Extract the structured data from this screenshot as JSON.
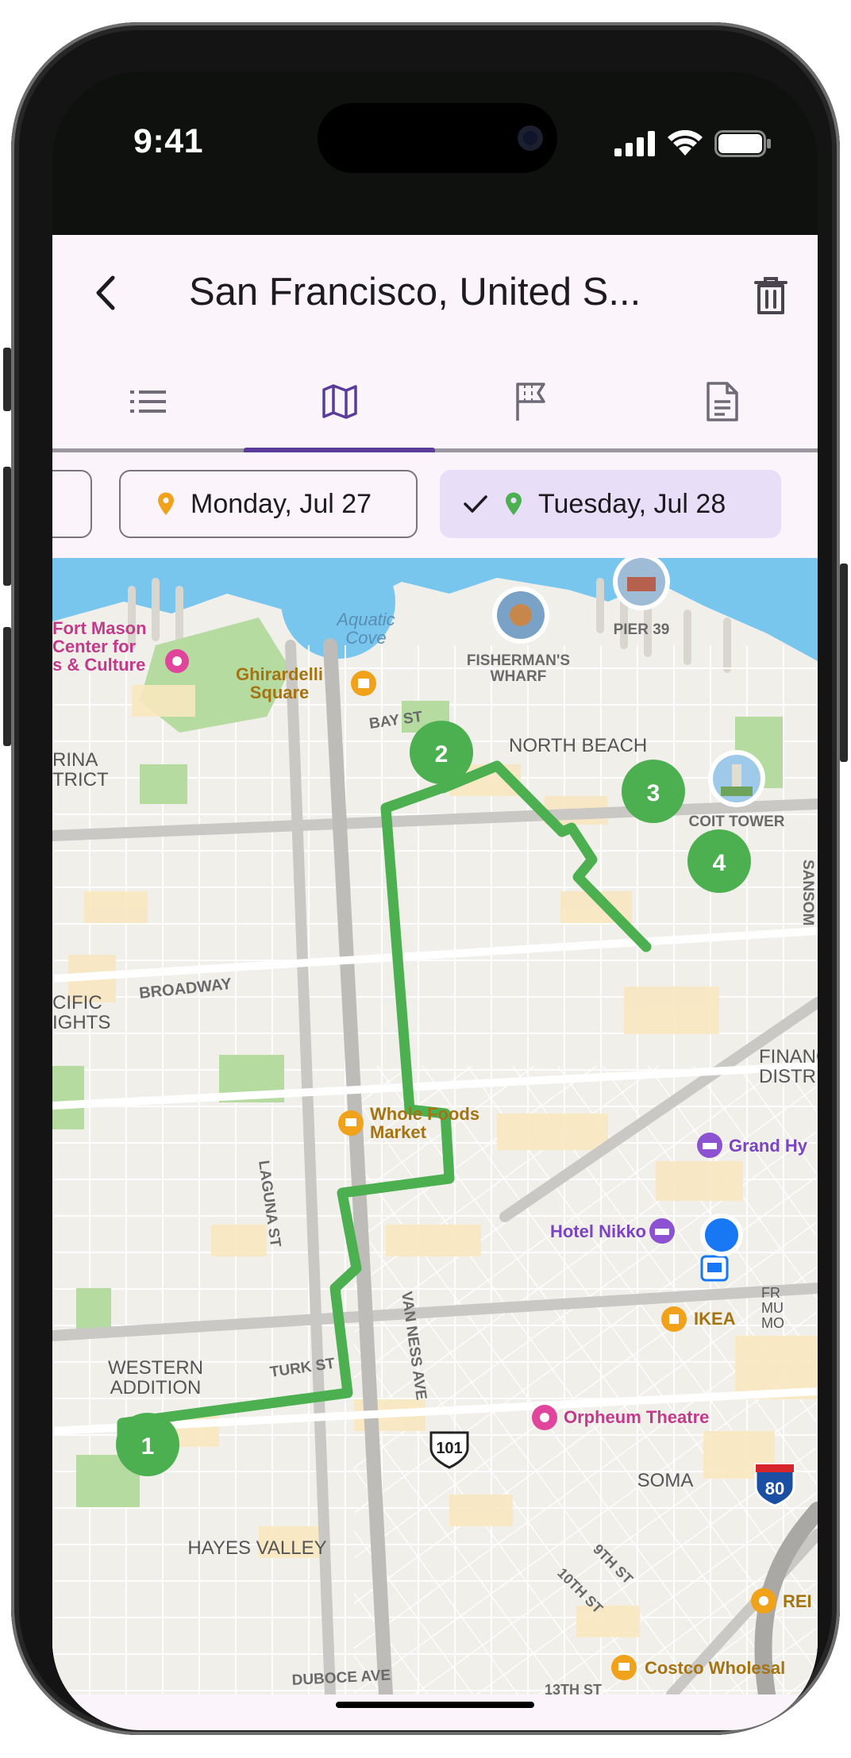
{
  "status_bar": {
    "time": "9:41"
  },
  "header": {
    "title": "San Francisco, United S..."
  },
  "tabs": [
    {
      "name": "list",
      "icon": "list-icon"
    },
    {
      "name": "map",
      "icon": "map-icon",
      "active": true
    },
    {
      "name": "flag",
      "icon": "flag-icon"
    },
    {
      "name": "document",
      "icon": "document-icon"
    }
  ],
  "day_chips": [
    {
      "label": "Monday, Jul 27",
      "selected": false
    },
    {
      "label": "Tuesday, Jul 28",
      "selected": true
    }
  ],
  "map": {
    "route_stops": [
      "1",
      "2",
      "3",
      "4"
    ],
    "places": {
      "aquatic_cove": "Aquatic\nCove",
      "fort_mason": "Fort Mason\nCenter for\ns & Culture",
      "ghirardelli": "Ghirardelli\nSquare",
      "fishermans_wharf": "FISHERMAN'S\nWHARF",
      "pier39": "PIER 39",
      "bay_st": "BAY ST",
      "north_beach": "NORTH BEACH",
      "coit_tower": "COIT TOWER",
      "marina": "RINA\nTRICT",
      "pacific_heights": "CIFIC\nIGHTS",
      "broadway": "BROADWAY",
      "sansome": "SANSOM",
      "financial": "FINANC\nDISTR",
      "whole_foods": "Whole Foods\nMarket",
      "grand_hyatt": "Grand Hy",
      "laguna_st": "LAGUNA ST",
      "hotel_nikko": "Hotel Nikko",
      "van_ness": "VAN NESS AVE",
      "ikea": "IKEA",
      "fr_mu": "FR\nMU\nMO",
      "western_addition": "WESTERN\nADDITION",
      "turk_st": "TURK ST",
      "orpheum": "Orpheum Theatre",
      "hwy101": "101",
      "soma": "SOMA",
      "i80": "80",
      "hayes_valley": "HAYES VALLEY",
      "ninth_st": "9TH ST",
      "tenth_st": "10TH ST",
      "rei": "REI",
      "duboce": "DUBOCE AVE",
      "costco": "Costco Wholesal",
      "thirteenth": "13TH ST"
    },
    "colors": {
      "route": "#4caf50",
      "water": "#78c6ee",
      "park": "#b5dba0",
      "poi_purple": "#8d52d1",
      "poi_orange": "#f0a21b",
      "poi_pink": "#e0459b",
      "user": "#1877f2"
    }
  }
}
